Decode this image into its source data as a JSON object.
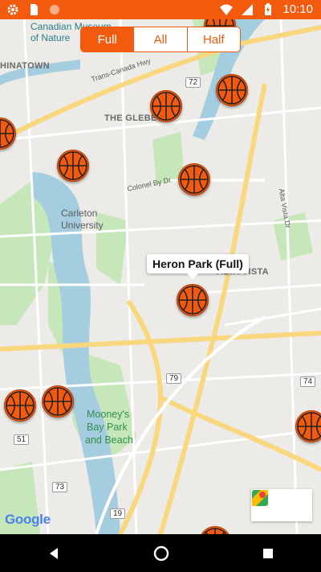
{
  "status_bar": {
    "time": "10:10",
    "icons": [
      "gear-icon",
      "sd-card-icon",
      "circle-icon",
      "wifi-icon",
      "signal-icon",
      "battery-icon"
    ]
  },
  "filter": {
    "options": [
      "Full",
      "All",
      "Half"
    ],
    "selected": "Full"
  },
  "map": {
    "labels": {
      "museum_line1": "Canadian Museum",
      "museum_line2": "of Nature",
      "chinatown": "HINATOWN",
      "glebe": "THE GLEBE",
      "trans_canada": "Trans-Canada Hwy",
      "colonel_by": "Colonel By Dr",
      "carleton1": "Carleton",
      "carleton2": "University",
      "alta_vista_dr": "Alta Vista Dr",
      "alta_vista": "ALTA VISTA",
      "mooneys1": "Mooney's",
      "mooneys2": "Bay Park",
      "mooneys3": "and Beach",
      "route72": "72",
      "route79": "79",
      "route74": "74",
      "route51": "51",
      "route73": "73",
      "route19": "19"
    },
    "tooltip": "Heron Park (Full)",
    "attribution": "Google",
    "colors": {
      "accent": "#f25a0d",
      "water": "#a5cde0",
      "park": "#c6e7b9",
      "road_major": "#f8d77e"
    }
  },
  "nav": {
    "icons": [
      "back-icon",
      "home-icon",
      "recents-icon"
    ]
  }
}
